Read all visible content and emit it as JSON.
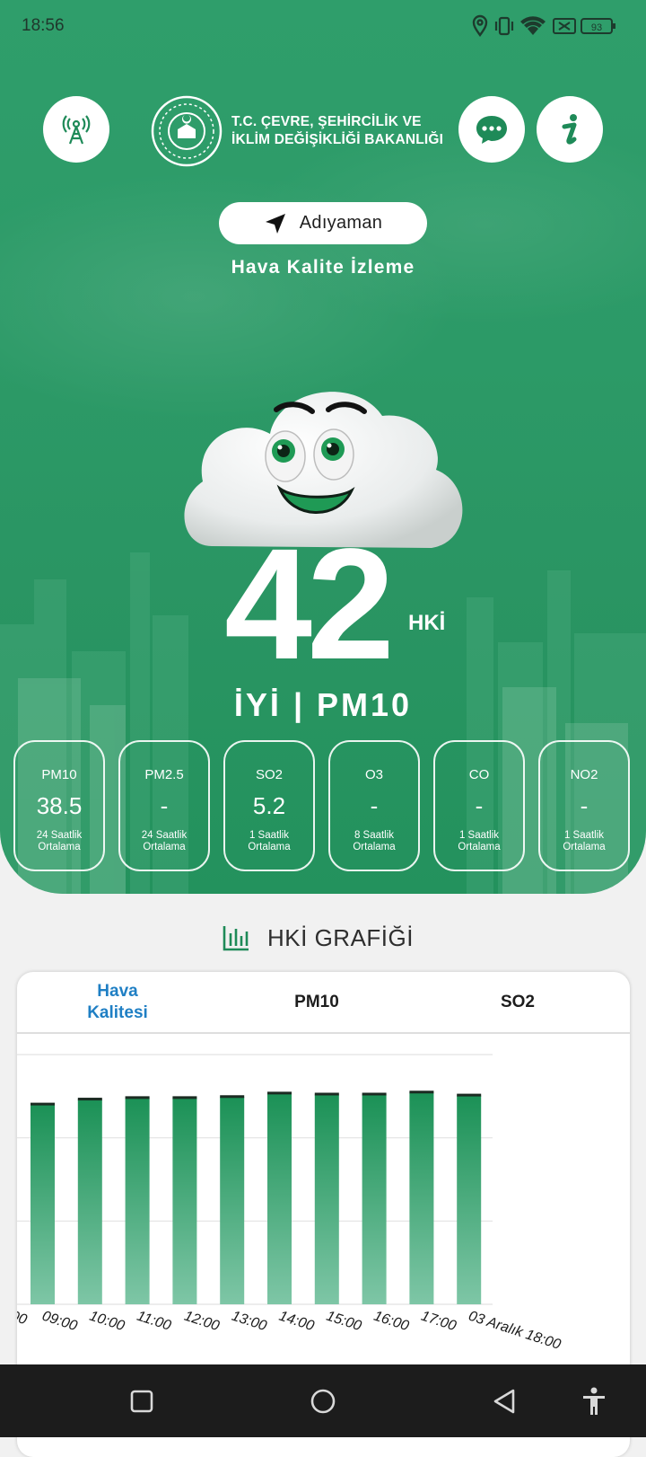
{
  "status_bar": {
    "time": "18:56",
    "battery": "93",
    "icons": [
      "location-icon",
      "vibrate-icon",
      "wifi-icon",
      "sim-off-icon",
      "battery-icon"
    ]
  },
  "header": {
    "ministry_line1": "T.C. ÇEVRE, ŞEHİRCİLİK VE",
    "ministry_line2": "İKLİM DEĞİŞİKLİĞİ BAKANLIĞI",
    "left_button_icon": "radio-tower-icon",
    "chat_button_icon": "chat-icon",
    "info_button_icon": "info-icon"
  },
  "location": {
    "name": "Adıyaman",
    "icon": "navigation-arrow-icon"
  },
  "subtitle": "Hava Kalite İzleme",
  "aqi": {
    "value": "42",
    "unit": "HKİ",
    "status": "İYİ | PM10"
  },
  "pollutants": [
    {
      "name": "PM10",
      "value": "38.5",
      "avg_line1": "24 Saatlik",
      "avg_line2": "Ortalama"
    },
    {
      "name": "PM2.5",
      "value": "-",
      "avg_line1": "24 Saatlik",
      "avg_line2": "Ortalama"
    },
    {
      "name": "SO2",
      "value": "5.2",
      "avg_line1": "1 Saatlik",
      "avg_line2": "Ortalama"
    },
    {
      "name": "O3",
      "value": "-",
      "avg_line1": "8 Saatlik",
      "avg_line2": "Ortalama"
    },
    {
      "name": "CO",
      "value": "-",
      "avg_line1": "1 Saatlik",
      "avg_line2": "Ortalama"
    },
    {
      "name": "NO2",
      "value": "-",
      "avg_line1": "1 Saatlik",
      "avg_line2": "Ortalama"
    }
  ],
  "graph": {
    "title": "HKİ GRAFİĞİ",
    "icon": "bar-chart-icon",
    "tabs": [
      {
        "label_line1": "Hava",
        "label_line2": "Kalitesi"
      },
      {
        "label_line1": "PM10",
        "label_line2": ""
      },
      {
        "label_line1": "SO2",
        "label_line2": ""
      }
    ]
  },
  "chart_data": {
    "type": "bar",
    "categories": [
      "09:00",
      "10:00",
      "11:00",
      "12:00",
      "13:00",
      "14:00",
      "15:00",
      "16:00",
      "17:00",
      "03 Aralık 18:00"
    ],
    "values": [
      40,
      41,
      41.3,
      41.3,
      41.5,
      42.2,
      42,
      42,
      42.4,
      41.8
    ],
    "first_label_fragment": "00",
    "ylim": [
      0,
      50
    ],
    "grid": true,
    "colors": {
      "bar_top": "#1b9156",
      "bar_bottom": "#7ec6a6",
      "cap": "#1b2b22"
    }
  },
  "nav": {
    "icons": [
      "recents-icon",
      "home-icon",
      "back-icon",
      "accessibility-icon"
    ]
  }
}
